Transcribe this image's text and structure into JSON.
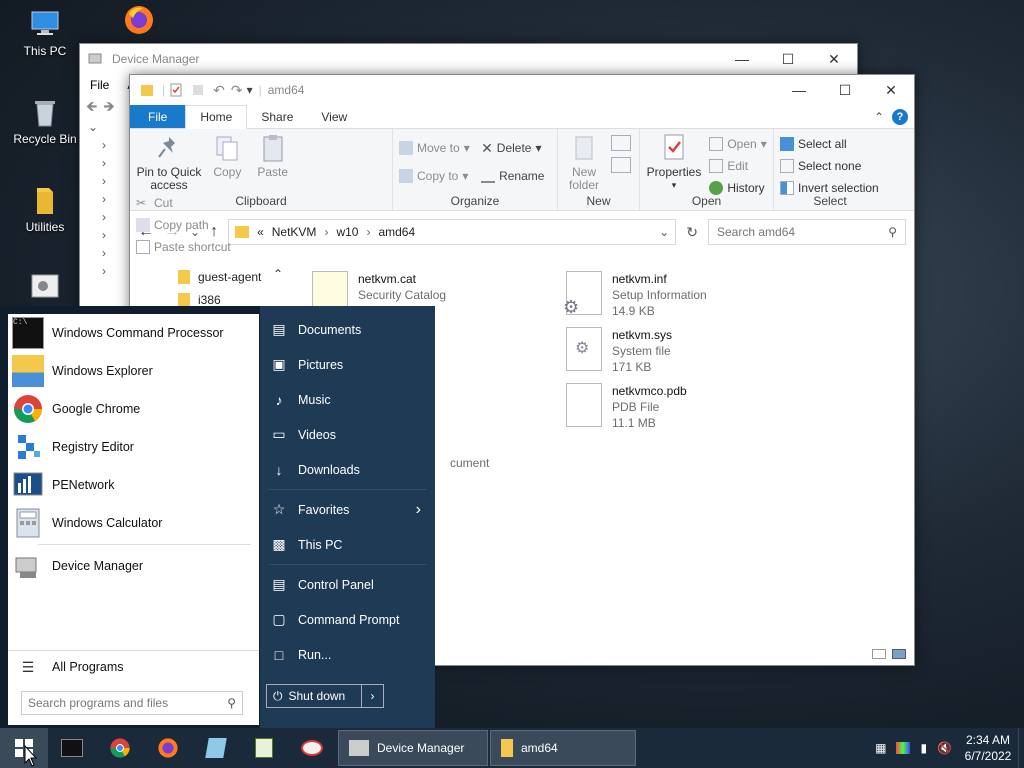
{
  "desktop": {
    "icons": [
      {
        "label": "This PC"
      },
      {
        "label": "Recycle Bin"
      },
      {
        "label": "Utilities"
      }
    ]
  },
  "device_manager": {
    "title": "Device Manager",
    "menu": [
      "File",
      "A"
    ]
  },
  "explorer": {
    "title": "amd64",
    "tabs": [
      "File",
      "Home",
      "Share",
      "View"
    ],
    "clipboard": {
      "pin": "Pin to Quick access",
      "copy": "Copy",
      "paste": "Paste",
      "cut": "Cut",
      "copy_path": "Copy path",
      "paste_shortcut": "Paste shortcut",
      "label": "Clipboard"
    },
    "organize": {
      "move_to": "Move to",
      "copy_to": "Copy to",
      "delete": "Delete",
      "rename": "Rename",
      "label": "Organize"
    },
    "new": {
      "new_folder": "New folder",
      "label": "New"
    },
    "open": {
      "properties": "Properties",
      "open": "Open",
      "edit": "Edit",
      "history": "History",
      "label": "Open"
    },
    "select": {
      "select_all": "Select all",
      "select_none": "Select none",
      "invert": "Invert selection",
      "label": "Select"
    },
    "address": {
      "chevrons": "«",
      "crumbs": [
        "NetKVM",
        "w10",
        "amd64"
      ],
      "search_placeholder": "Search amd64"
    },
    "nav": [
      "guest-agent",
      "i386"
    ],
    "files": [
      {
        "name": "netkvm.cat",
        "type": "Security Catalog",
        "size": ""
      },
      {
        "name": "netkvm.inf",
        "type": "Setup Information",
        "size": "14.9 KB"
      },
      {
        "name": "netkvm.sys",
        "type": "System file",
        "size": "171 KB"
      },
      {
        "name": "netkvmco.pdb",
        "type": "PDB File",
        "size": "11.1 MB"
      }
    ],
    "partial_text": "cument"
  },
  "start_menu": {
    "programs": [
      {
        "label": "Windows Command Processor"
      },
      {
        "label": "Windows Explorer"
      },
      {
        "label": "Google Chrome"
      },
      {
        "label": "Registry Editor"
      },
      {
        "label": "PENetwork"
      },
      {
        "label": "Windows Calculator"
      },
      {
        "label": "Device Manager"
      }
    ],
    "all_programs": "All Programs",
    "search_placeholder": "Search programs and files",
    "places": [
      {
        "label": "Documents",
        "icon": "doc-icon"
      },
      {
        "label": "Pictures",
        "icon": "picture-icon"
      },
      {
        "label": "Music",
        "icon": "music-icon"
      },
      {
        "label": "Videos",
        "icon": "video-icon"
      },
      {
        "label": "Downloads",
        "icon": "download-icon"
      },
      {
        "label": "Favorites",
        "icon": "star-icon"
      },
      {
        "label": "This PC",
        "icon": "computer-icon"
      },
      {
        "label": "Control Panel",
        "icon": "control-panel-icon"
      },
      {
        "label": "Command Prompt",
        "icon": "cmd-icon"
      },
      {
        "label": "Run...",
        "icon": "run-icon"
      }
    ],
    "shutdown": "Shut down"
  },
  "taskbar": {
    "apps": [
      {
        "label": "Device Manager"
      },
      {
        "label": "amd64"
      }
    ],
    "time": "2:34 AM",
    "date": "6/7/2022"
  },
  "colors": {
    "accent": "#1979ca",
    "start_right": "#1f3a55",
    "taskbar": "#1b2a3a"
  }
}
